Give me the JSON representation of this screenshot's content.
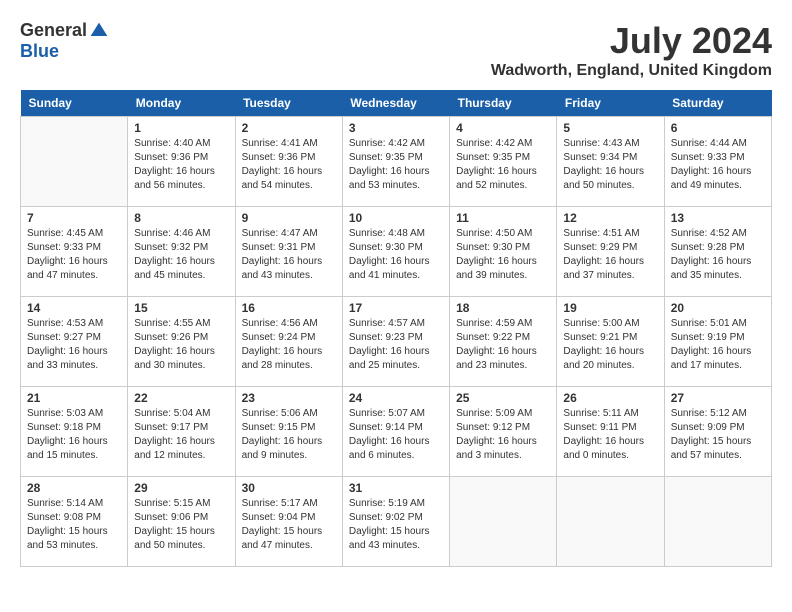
{
  "header": {
    "logo": {
      "general": "General",
      "blue": "Blue"
    },
    "title": "July 2024",
    "location": "Wadworth, England, United Kingdom"
  },
  "weekdays": [
    "Sunday",
    "Monday",
    "Tuesday",
    "Wednesday",
    "Thursday",
    "Friday",
    "Saturday"
  ],
  "weeks": [
    [
      {
        "day": "",
        "info": ""
      },
      {
        "day": "1",
        "info": "Sunrise: 4:40 AM\nSunset: 9:36 PM\nDaylight: 16 hours\nand 56 minutes."
      },
      {
        "day": "2",
        "info": "Sunrise: 4:41 AM\nSunset: 9:36 PM\nDaylight: 16 hours\nand 54 minutes."
      },
      {
        "day": "3",
        "info": "Sunrise: 4:42 AM\nSunset: 9:35 PM\nDaylight: 16 hours\nand 53 minutes."
      },
      {
        "day": "4",
        "info": "Sunrise: 4:42 AM\nSunset: 9:35 PM\nDaylight: 16 hours\nand 52 minutes."
      },
      {
        "day": "5",
        "info": "Sunrise: 4:43 AM\nSunset: 9:34 PM\nDaylight: 16 hours\nand 50 minutes."
      },
      {
        "day": "6",
        "info": "Sunrise: 4:44 AM\nSunset: 9:33 PM\nDaylight: 16 hours\nand 49 minutes."
      }
    ],
    [
      {
        "day": "7",
        "info": "Sunrise: 4:45 AM\nSunset: 9:33 PM\nDaylight: 16 hours\nand 47 minutes."
      },
      {
        "day": "8",
        "info": "Sunrise: 4:46 AM\nSunset: 9:32 PM\nDaylight: 16 hours\nand 45 minutes."
      },
      {
        "day": "9",
        "info": "Sunrise: 4:47 AM\nSunset: 9:31 PM\nDaylight: 16 hours\nand 43 minutes."
      },
      {
        "day": "10",
        "info": "Sunrise: 4:48 AM\nSunset: 9:30 PM\nDaylight: 16 hours\nand 41 minutes."
      },
      {
        "day": "11",
        "info": "Sunrise: 4:50 AM\nSunset: 9:30 PM\nDaylight: 16 hours\nand 39 minutes."
      },
      {
        "day": "12",
        "info": "Sunrise: 4:51 AM\nSunset: 9:29 PM\nDaylight: 16 hours\nand 37 minutes."
      },
      {
        "day": "13",
        "info": "Sunrise: 4:52 AM\nSunset: 9:28 PM\nDaylight: 16 hours\nand 35 minutes."
      }
    ],
    [
      {
        "day": "14",
        "info": "Sunrise: 4:53 AM\nSunset: 9:27 PM\nDaylight: 16 hours\nand 33 minutes."
      },
      {
        "day": "15",
        "info": "Sunrise: 4:55 AM\nSunset: 9:26 PM\nDaylight: 16 hours\nand 30 minutes."
      },
      {
        "day": "16",
        "info": "Sunrise: 4:56 AM\nSunset: 9:24 PM\nDaylight: 16 hours\nand 28 minutes."
      },
      {
        "day": "17",
        "info": "Sunrise: 4:57 AM\nSunset: 9:23 PM\nDaylight: 16 hours\nand 25 minutes."
      },
      {
        "day": "18",
        "info": "Sunrise: 4:59 AM\nSunset: 9:22 PM\nDaylight: 16 hours\nand 23 minutes."
      },
      {
        "day": "19",
        "info": "Sunrise: 5:00 AM\nSunset: 9:21 PM\nDaylight: 16 hours\nand 20 minutes."
      },
      {
        "day": "20",
        "info": "Sunrise: 5:01 AM\nSunset: 9:19 PM\nDaylight: 16 hours\nand 17 minutes."
      }
    ],
    [
      {
        "day": "21",
        "info": "Sunrise: 5:03 AM\nSunset: 9:18 PM\nDaylight: 16 hours\nand 15 minutes."
      },
      {
        "day": "22",
        "info": "Sunrise: 5:04 AM\nSunset: 9:17 PM\nDaylight: 16 hours\nand 12 minutes."
      },
      {
        "day": "23",
        "info": "Sunrise: 5:06 AM\nSunset: 9:15 PM\nDaylight: 16 hours\nand 9 minutes."
      },
      {
        "day": "24",
        "info": "Sunrise: 5:07 AM\nSunset: 9:14 PM\nDaylight: 16 hours\nand 6 minutes."
      },
      {
        "day": "25",
        "info": "Sunrise: 5:09 AM\nSunset: 9:12 PM\nDaylight: 16 hours\nand 3 minutes."
      },
      {
        "day": "26",
        "info": "Sunrise: 5:11 AM\nSunset: 9:11 PM\nDaylight: 16 hours\nand 0 minutes."
      },
      {
        "day": "27",
        "info": "Sunrise: 5:12 AM\nSunset: 9:09 PM\nDaylight: 15 hours\nand 57 minutes."
      }
    ],
    [
      {
        "day": "28",
        "info": "Sunrise: 5:14 AM\nSunset: 9:08 PM\nDaylight: 15 hours\nand 53 minutes."
      },
      {
        "day": "29",
        "info": "Sunrise: 5:15 AM\nSunset: 9:06 PM\nDaylight: 15 hours\nand 50 minutes."
      },
      {
        "day": "30",
        "info": "Sunrise: 5:17 AM\nSunset: 9:04 PM\nDaylight: 15 hours\nand 47 minutes."
      },
      {
        "day": "31",
        "info": "Sunrise: 5:19 AM\nSunset: 9:02 PM\nDaylight: 15 hours\nand 43 minutes."
      },
      {
        "day": "",
        "info": ""
      },
      {
        "day": "",
        "info": ""
      },
      {
        "day": "",
        "info": ""
      }
    ]
  ]
}
